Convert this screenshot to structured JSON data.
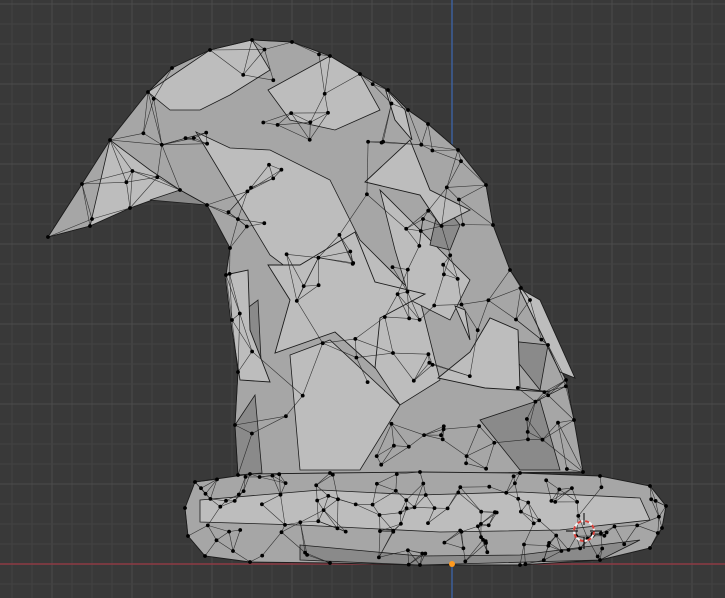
{
  "viewport": {
    "mode": "edit-mode",
    "view": "front-orthographic",
    "object_kind": "low-poly-mesh",
    "object_shape": "wizard-hat"
  },
  "colors": {
    "background": "#393939",
    "grid_minor": "#424242",
    "grid_major": "#4c4c4c",
    "x_axis": "#8e3a44",
    "z_axis": "#3c5f9a",
    "face_light": "#bdbdbd",
    "face_mid": "#a6a6a6",
    "face_dark": "#8a8a8a",
    "edge": "#1c1c1c",
    "vertex": "#000000",
    "cursor_red": "#d8403a",
    "cursor_white": "#f2f2f2",
    "origin": "#ff9a1f"
  },
  "icons": {
    "cursor": "3d-cursor-icon",
    "origin": "origin-point-icon"
  }
}
